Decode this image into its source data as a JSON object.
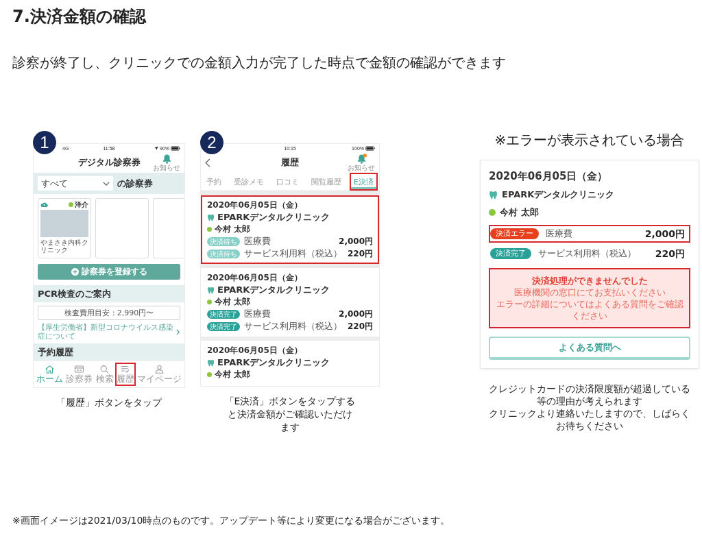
{
  "heading": {
    "title": "7.決済金額の確認",
    "lead": "診察が終了し、クリニックでの金額入力が完了した時点で金額の確認ができます"
  },
  "steps": [
    {
      "number": "1",
      "kind": "home",
      "phone": {
        "status_bar": {
          "carrier": "4G",
          "time": "11:58",
          "location_on": true,
          "battery": "90%"
        },
        "header": {
          "title": "デジタル診察券",
          "notice_label": "お知らせ",
          "unread": false
        },
        "filter": {
          "value": "すべて",
          "suffix": "の診察券"
        },
        "cards": [
          {
            "kind": "clinic",
            "patient": "洋介",
            "clinic": "やまさき内科クリニック"
          },
          {
            "kind": "empty"
          },
          {
            "kind": "empty"
          }
        ],
        "register_button": "診察券を登録する",
        "pcr": {
          "title": "PCR検査のご案内",
          "price": "検査費用目安：2,990円〜",
          "link": "【厚生労働省】新型コロナウイルス感染症について"
        },
        "history_title": "予約履歴",
        "nav": [
          {
            "label": "ホーム",
            "selected": true,
            "highlighted": false
          },
          {
            "label": "診察券",
            "selected": false,
            "highlighted": false
          },
          {
            "label": "検索",
            "selected": false,
            "highlighted": false
          },
          {
            "label": "履歴",
            "selected": false,
            "highlighted": true
          },
          {
            "label": "マイページ",
            "selected": false,
            "highlighted": false
          }
        ]
      },
      "caption": "「履歴」ボタンをタップ"
    },
    {
      "number": "2",
      "kind": "history",
      "phone": {
        "status_bar": {
          "time": "10:15",
          "location_on": false,
          "battery": "100%"
        },
        "header": {
          "title": "履歴",
          "notice_label": "お知らせ",
          "unread": true
        },
        "tabs": [
          {
            "label": "予約",
            "selected": false,
            "highlighted": false
          },
          {
            "label": "受診メモ",
            "selected": false,
            "highlighted": false
          },
          {
            "label": "口コミ",
            "selected": false,
            "highlighted": false
          },
          {
            "label": "閲覧履歴",
            "selected": false,
            "highlighted": false
          },
          {
            "label": "E決済",
            "selected": true,
            "highlighted": true
          }
        ],
        "payments": [
          {
            "date": "2020年06月05日（金）",
            "clinic": "EPARKデンタルクリニック",
            "patient": "今村 太郎",
            "highlighted": true,
            "lines": [
              {
                "kind": "pending",
                "status": "決済待ち",
                "item": "医療費",
                "amount": "2,000円"
              },
              {
                "kind": "pending",
                "status": "決済待ち",
                "item": "サービス利用料（税込）",
                "amount": "220円"
              }
            ]
          },
          {
            "date": "2020年06月05日（金）",
            "clinic": "EPARKデンタルクリニック",
            "patient": "今村 太郎",
            "highlighted": false,
            "lines": [
              {
                "kind": "done",
                "status": "決済完了",
                "item": "医療費",
                "amount": "2,000円"
              },
              {
                "kind": "done",
                "status": "決済完了",
                "item": "サービス利用料（税込）",
                "amount": "220円"
              }
            ]
          },
          {
            "date": "2020年06月05日（金）",
            "clinic": "EPARKデンタルクリニック",
            "patient": "今村 太郎",
            "highlighted": false
          }
        ]
      },
      "caption": "「E決済」ボタンをタップすると決済金額がご確認いただけます"
    }
  ],
  "error_case": {
    "title": "※エラーが表示されている場合",
    "card": {
      "date": "2020年06月05日（金）",
      "clinic": "EPARKデンタルクリニック",
      "patient": "今村 太郎",
      "lines": [
        {
          "kind": "error",
          "status": "決済エラー",
          "item": "医療費",
          "amount": "2,000円",
          "highlighted": true
        },
        {
          "kind": "done",
          "status": "決済完了",
          "item": "サービス利用料（税込）",
          "amount": "220円",
          "highlighted": false
        }
      ],
      "error": {
        "title": "決済処理ができませんでした",
        "lines": [
          "医療機関の窓口にてお支払いください",
          "エラーの詳細についてはよくある質問をご確認ください"
        ],
        "highlighted": true
      },
      "faq_button": "よくある質問へ"
    },
    "notes": [
      "クレジットカードの決済限度額が超過している等の理由が考えられます",
      "クリニックより連絡いたしますので、しばらくお待ちください"
    ]
  },
  "footnote": "※画面イメージは2021/03/10時点のものです。アップデート等により変更になる場合がございます。"
}
